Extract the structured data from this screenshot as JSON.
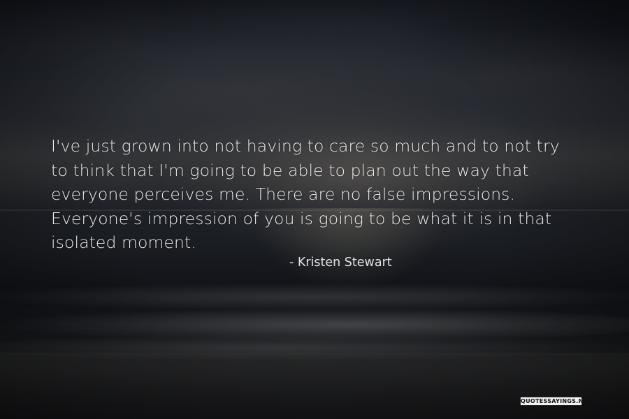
{
  "quote": {
    "lines": [
      "I've just grown into not having to care so much and to not try",
      "to think that I'm going to be able to plan out the way that",
      "everyone perceives me. There are no false impressions.",
      "Everyone's impression of you is going to be what it is in that",
      "isolated moment."
    ],
    "author": "- Kristen Stewart"
  },
  "watermark": "QUOTESSAYINGS.NET",
  "background": {
    "scene": "sunset over sea with waves breaking on shore",
    "sky_color": "#272a31",
    "text_color": "#ececec"
  }
}
